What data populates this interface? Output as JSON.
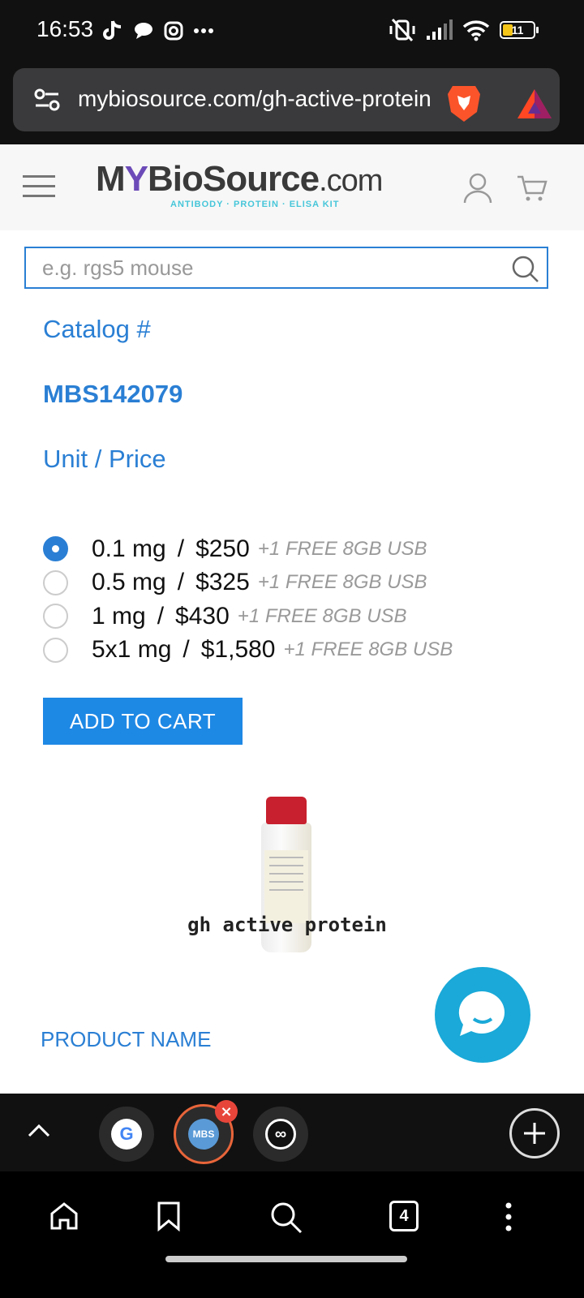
{
  "status_bar": {
    "time": "16:53",
    "battery_level": "11",
    "icons_left": [
      "tiktok-icon",
      "chat-icon",
      "instagram-icon",
      "more-dots-icon"
    ],
    "icons_right": [
      "vibrate-off-icon",
      "signal-icon",
      "wifi-icon",
      "battery-icon"
    ]
  },
  "browser": {
    "url": "mybiosource.com/gh-active-protein",
    "colors": {
      "accent": "#e8653a",
      "toolbar_bg": "#3a3a3c"
    }
  },
  "site": {
    "logo_text_a": "M",
    "logo_text_y": "Y",
    "logo_text_b": "BioSource",
    "logo_suffix": ".com",
    "logo_tagline": "ANTIBODY · PROTEIN · ELISA KIT",
    "search_placeholder": "e.g. rgs5 mouse"
  },
  "product": {
    "catalog_label": "Catalog #",
    "catalog_number": "MBS142079",
    "unit_price_label": "Unit / Price",
    "options": [
      {
        "size": "0.1 mg",
        "price": "$250",
        "promo": "+1 FREE 8GB USB",
        "selected": true
      },
      {
        "size": "0.5 mg",
        "price": "$325",
        "promo": "+1 FREE 8GB USB",
        "selected": false
      },
      {
        "size": "1 mg",
        "price": "$430",
        "promo": "+1 FREE 8GB USB",
        "selected": false
      },
      {
        "size": "5x1 mg",
        "price": "$1,580",
        "promo": "+1 FREE 8GB USB",
        "selected": false
      }
    ],
    "separator": "/",
    "add_to_cart_label": "ADD TO CART",
    "image_caption": "gh active protein",
    "product_name_label": "PRODUCT NAME",
    "colors": {
      "link": "#2a7fd4",
      "button": "#1e88e5",
      "chat": "#1aa9d8"
    }
  },
  "bottom_bar": {
    "tabs": [
      {
        "name": "google-tab",
        "glyph": "G"
      },
      {
        "name": "mybiosource-tab",
        "glyph": "MBS",
        "active": true
      },
      {
        "name": "other-tab",
        "glyph": "∞"
      }
    ],
    "tab_count": "4",
    "nav_items": [
      "home-icon",
      "bookmark-icon",
      "search-icon",
      "tabs-counter",
      "menu-icon"
    ]
  }
}
